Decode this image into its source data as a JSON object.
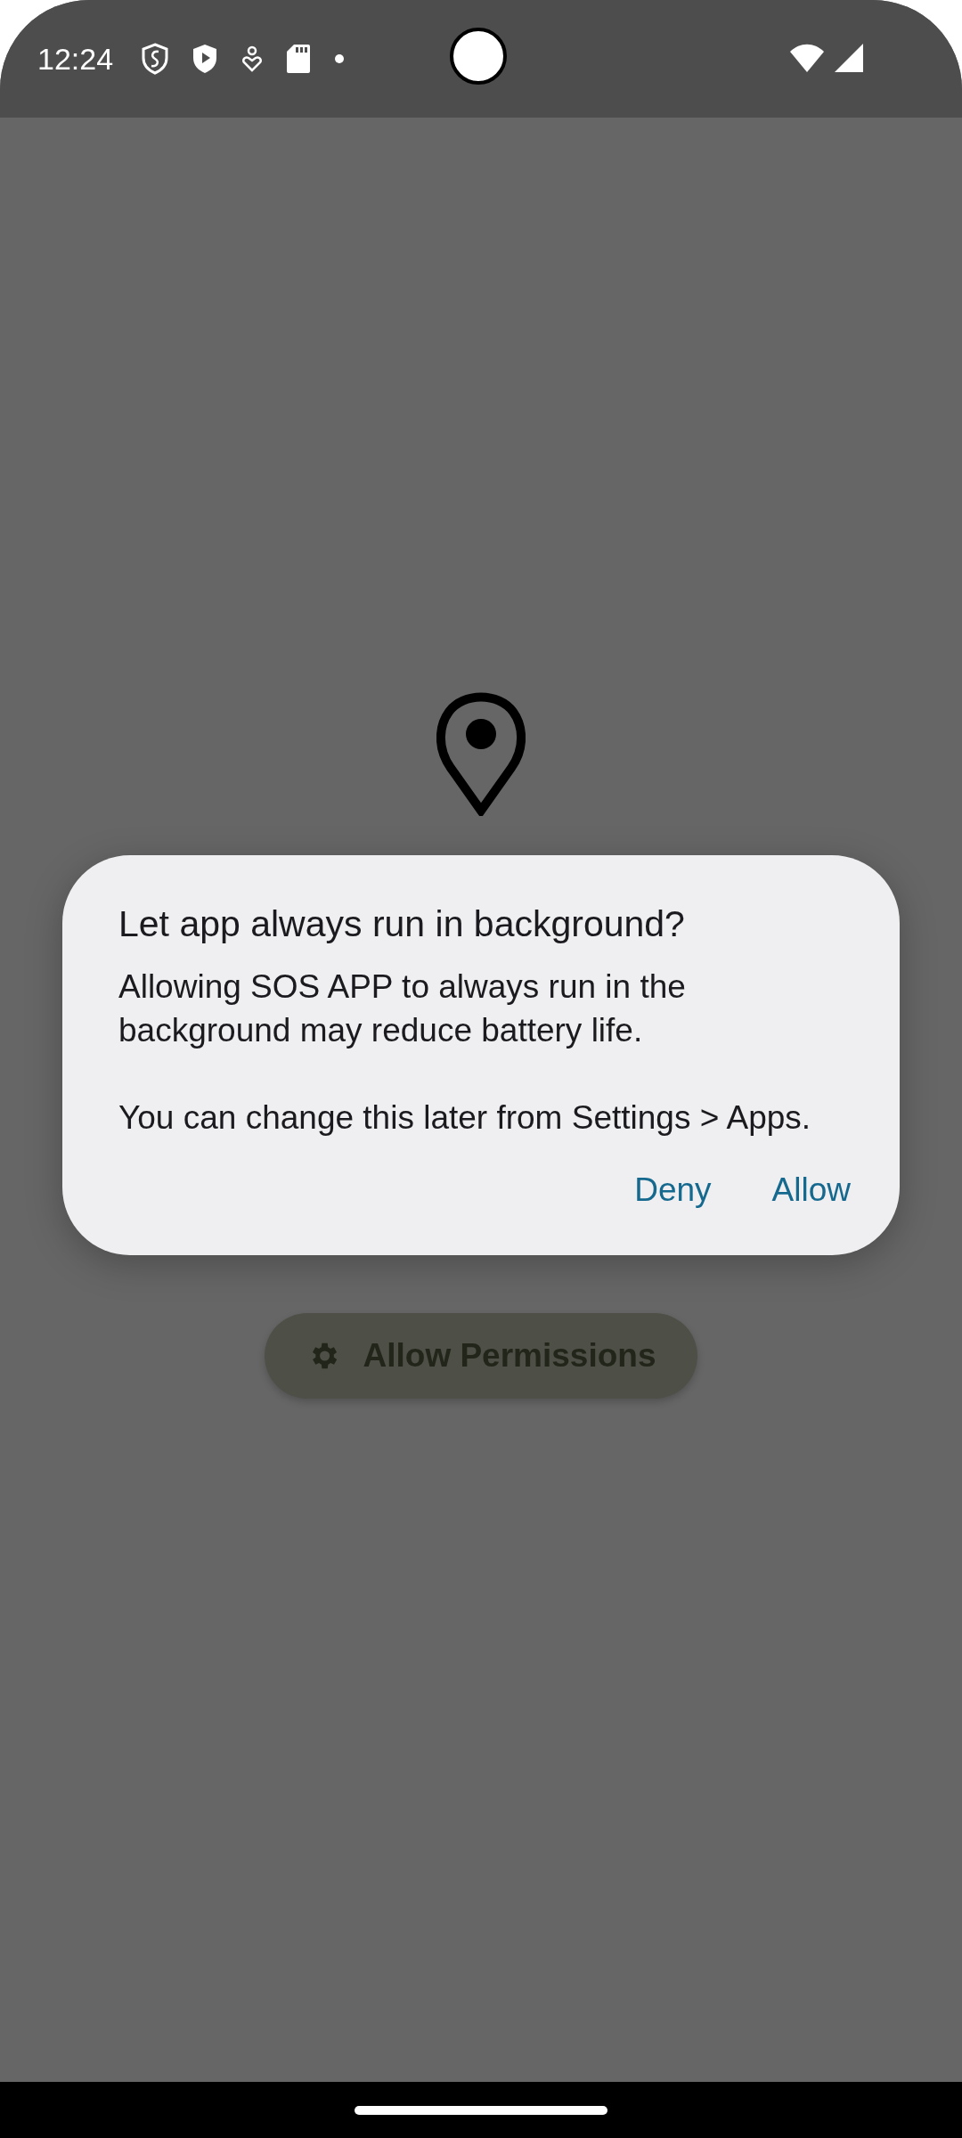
{
  "status_bar": {
    "time": "12:24"
  },
  "screen": {
    "button": {
      "label": "Allow Permissions"
    }
  },
  "dialog": {
    "title": "Let app always run in background?",
    "paragraphs": [
      "Allowing SOS APP to always run in the background may reduce battery life.",
      "You can change this later from Settings > Apps."
    ],
    "actions": [
      {
        "label": "Deny"
      },
      {
        "label": "Allow"
      }
    ]
  }
}
